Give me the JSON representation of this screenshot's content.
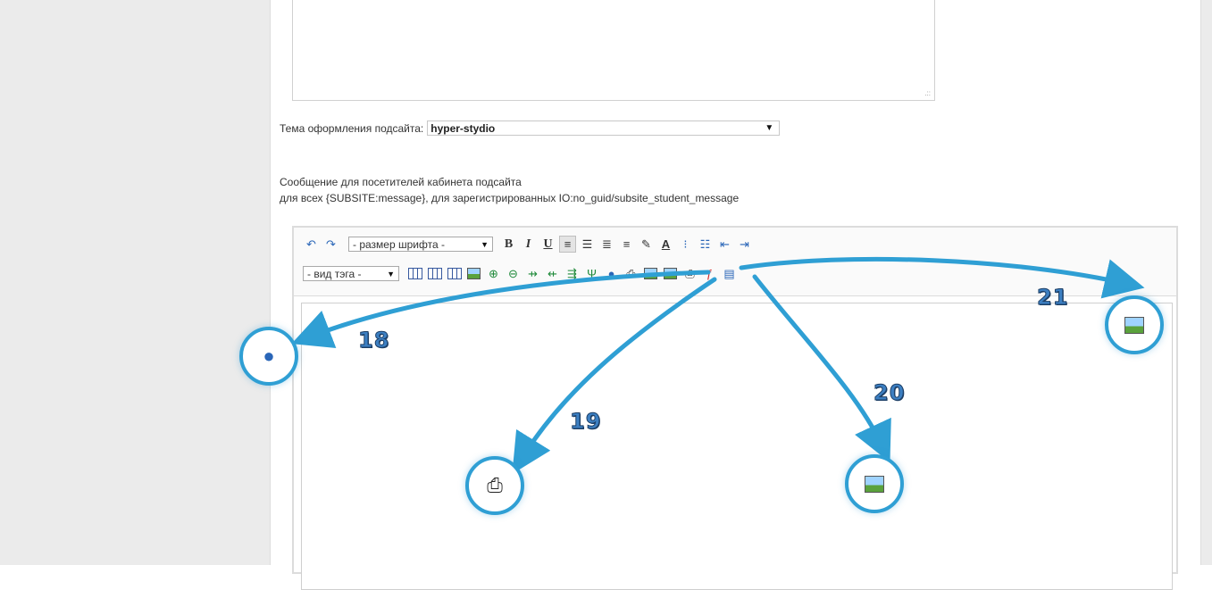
{
  "layout": {
    "accent_color": "#2f9fd4"
  },
  "theme": {
    "label": "Тема оформления подсайта:",
    "selected": "hyper-stydio"
  },
  "message": {
    "line1": "Сообщение для посетителей кабинета подсайта",
    "line2": "для всех {SUBSITE:message}, для зарегистрированных IO:no_guid/subsite_student_message"
  },
  "toolbar": {
    "font_size_select": "- размер шрифта -",
    "tag_select": "- вид тэга -",
    "bold": "B",
    "italic": "I",
    "underline": "U",
    "text_color": "A",
    "icons_row1": [
      "undo-icon",
      "redo-icon",
      "bold-icon",
      "italic-icon",
      "underline-icon",
      "align-left-icon",
      "align-center-icon",
      "align-right-icon",
      "align-justify-icon",
      "highlight-icon",
      "text-color-icon",
      "bullet-list-icon",
      "numbered-list-icon",
      "outdent-icon",
      "indent-icon"
    ],
    "icons_row2": [
      "table-icon",
      "table-edit-icon",
      "table-props-icon",
      "cell-image-icon",
      "insert-row-icon",
      "delete-row-icon",
      "insert-col-icon",
      "delete-col-icon",
      "merge-cells-icon",
      "split-cell-icon",
      "link-icon",
      "form-icon",
      "image-icon",
      "gallery-icon",
      "print-icon",
      "flash-icon",
      "save-icon"
    ]
  },
  "callouts": [
    {
      "number": "18",
      "icon": "link-icon"
    },
    {
      "number": "19",
      "icon": "form-icon"
    },
    {
      "number": "20",
      "icon": "image-icon"
    },
    {
      "number": "21",
      "icon": "gallery-icon"
    }
  ]
}
